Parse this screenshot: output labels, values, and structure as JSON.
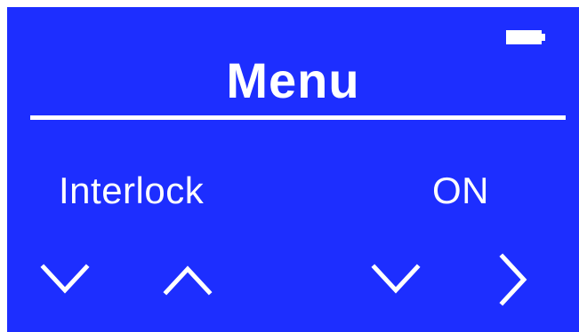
{
  "header": {
    "title": "Menu",
    "battery_icon": "battery-full-icon"
  },
  "setting": {
    "label": "Interlock",
    "value": "ON"
  },
  "controls": {
    "down_left_icon": "chevron-down-icon",
    "up_icon": "chevron-up-icon",
    "down_right_icon": "chevron-down-icon",
    "right_icon": "chevron-right-icon"
  },
  "colors": {
    "background": "#1d2eff",
    "foreground": "#ffffff"
  }
}
